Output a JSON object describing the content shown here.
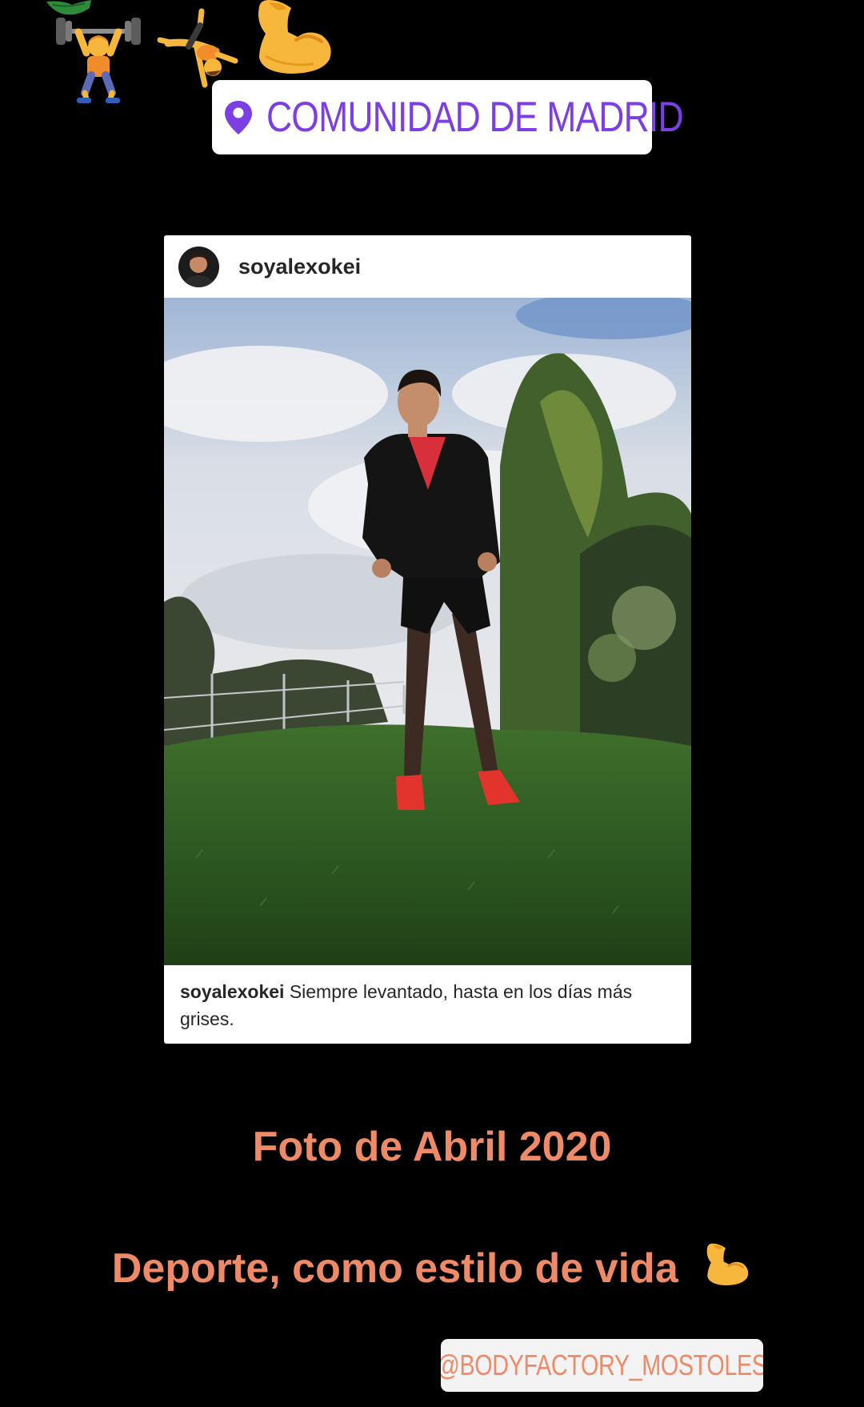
{
  "location": {
    "label": "COMUNIDAD DE MADRID"
  },
  "post": {
    "username": "soyalexokei",
    "caption_user": "soyalexokei",
    "caption_text": "Siempre levantado, hasta en los días más grises."
  },
  "story_text": {
    "line1": "Foto de Abril 2020",
    "line2": "Deporte, como estilo de vida"
  },
  "mention": {
    "label": "@BODYFACTORY_MOSTOLES"
  },
  "icons": {
    "location": "map-pin-icon",
    "stickers": [
      "leaf-emoji",
      "weightlifter-emoji",
      "cartwheel-emoji",
      "flexed-biceps-emoji"
    ],
    "inline": "flexed-biceps-emoji"
  },
  "colors": {
    "background": "#000000",
    "location_text": "#7b3fe4",
    "story_text": "#ee8a67",
    "mention_bg": "#f3f3f3"
  }
}
